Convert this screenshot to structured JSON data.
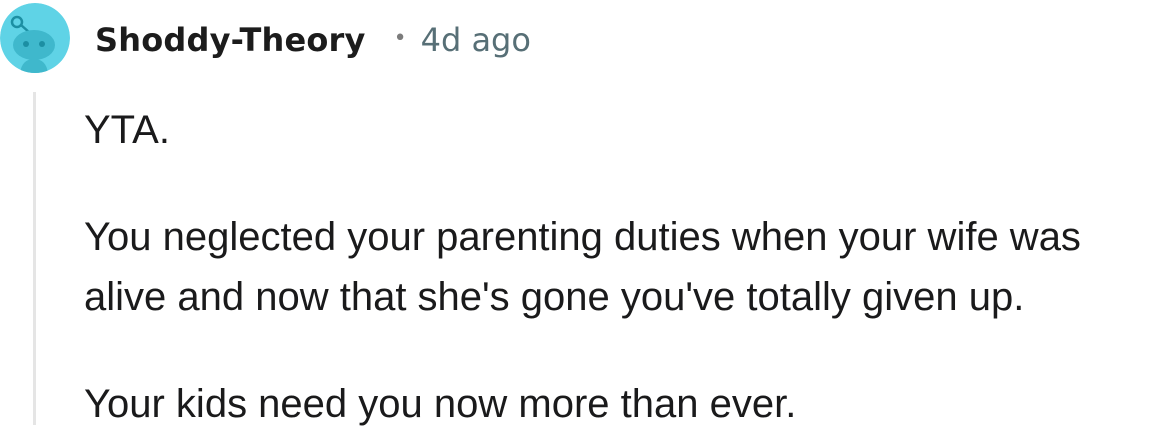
{
  "comment": {
    "author": "Shoddy-Theory",
    "separator": "•",
    "age": "4d ago",
    "avatar_icon": "snoo-avatar-icon",
    "avatar_color": "#5fd3e6",
    "paragraphs": [
      [
        "YTA."
      ],
      [
        "You neglected your parenting duties when your wife was",
        "alive and now that she's gone you've totally given up."
      ],
      [
        "Your kids need you now more than ever."
      ]
    ]
  }
}
